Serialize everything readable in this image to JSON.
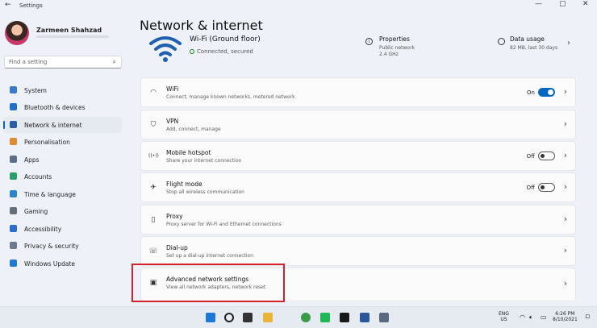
{
  "window": {
    "title": "Settings",
    "back_glyph": "←",
    "min_glyph": "—",
    "max_glyph": "▢",
    "close_glyph": "✕"
  },
  "user": {
    "name": "Zarmeen Shahzad"
  },
  "search": {
    "placeholder": "Find a setting"
  },
  "nav": [
    {
      "label": "System",
      "icon": "monitor-icon",
      "color": "#3a78c9"
    },
    {
      "label": "Bluetooth & devices",
      "icon": "bluetooth-icon",
      "color": "#1e73c8"
    },
    {
      "label": "Network & internet",
      "icon": "wifi-icon",
      "color": "#2a5fa8",
      "active": true
    },
    {
      "label": "Personalisation",
      "icon": "brush-icon",
      "color": "#e08a2e"
    },
    {
      "label": "Apps",
      "icon": "apps-icon",
      "color": "#5b6e88"
    },
    {
      "label": "Accounts",
      "icon": "person-icon",
      "color": "#2a9d6a"
    },
    {
      "label": "Time & language",
      "icon": "globe-clock-icon",
      "color": "#2a86c9"
    },
    {
      "label": "Gaming",
      "icon": "gamepad-icon",
      "color": "#666e7a"
    },
    {
      "label": "Accessibility",
      "icon": "accessibility-icon",
      "color": "#2a6fc9"
    },
    {
      "label": "Privacy & security",
      "icon": "shield-icon",
      "color": "#6f7a88"
    },
    {
      "label": "Windows Update",
      "icon": "update-icon",
      "color": "#1f7ad0"
    }
  ],
  "page": {
    "title": "Network & internet"
  },
  "hero": {
    "network_name": "Wi-Fi (Ground floor)",
    "status": "Connected, secured",
    "properties": {
      "title": "Properties",
      "line1": "Public network",
      "line2": "2.4 GHz"
    },
    "usage": {
      "title": "Data usage",
      "line1": "82 MB, last 30 days"
    }
  },
  "cards": [
    {
      "title": "WiFi",
      "subtitle": "Connect, manage known networks, metered network",
      "icon": "wifi-icon",
      "toggle": "on",
      "state": "On"
    },
    {
      "title": "VPN",
      "subtitle": "Add, connect, manage",
      "icon": "vpn-shield-icon"
    },
    {
      "title": "Mobile hotspot",
      "subtitle": "Share your internet connection",
      "icon": "hotspot-icon",
      "toggle": "off",
      "state": "Off"
    },
    {
      "title": "Flight mode",
      "subtitle": "Stop all wireless communication",
      "icon": "airplane-icon",
      "toggle": "off",
      "state": "Off"
    },
    {
      "title": "Proxy",
      "subtitle": "Proxy server for Wi-Fi and Ethernet connections",
      "icon": "proxy-icon"
    },
    {
      "title": "Dial-up",
      "subtitle": "Set up a dial-up internet connection",
      "icon": "dialup-icon"
    },
    {
      "title": "Advanced network settings",
      "subtitle": "View all network adapters, network reset",
      "icon": "network-adapter-icon"
    }
  ],
  "taskbar": {
    "language_top": "ENG",
    "language_bottom": "US",
    "time": "6:26 PM",
    "date": "8/10/2021",
    "apps": [
      {
        "name": "start-icon",
        "color": "#1e78d6"
      },
      {
        "name": "search-icon",
        "color": "#222222"
      },
      {
        "name": "task-view-icon",
        "color": "#333333"
      },
      {
        "name": "file-explorer-icon",
        "color": "#e8b53a"
      },
      {
        "name": "chrome-icon",
        "color": "#3b9b4a"
      },
      {
        "name": "spotify-icon",
        "color": "#1db954"
      },
      {
        "name": "netflix-icon",
        "color": "#1a1a1a"
      },
      {
        "name": "word-icon",
        "color": "#2b579a"
      },
      {
        "name": "settings-icon",
        "color": "#5a6a80"
      }
    ]
  }
}
